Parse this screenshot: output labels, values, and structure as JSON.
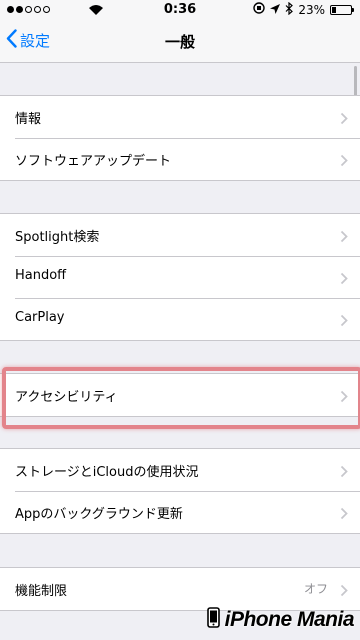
{
  "status_bar": {
    "time": "0:36",
    "battery": "23%",
    "signal_dots": 2
  },
  "nav": {
    "back_label": "設定",
    "title": "一般"
  },
  "groups": [
    {
      "rows": [
        {
          "label": "情報"
        },
        {
          "label": "ソフトウェアアップデート"
        }
      ]
    },
    {
      "rows": [
        {
          "label": "Spotlight検索"
        },
        {
          "label": "Handoff"
        },
        {
          "label": "CarPlay"
        }
      ]
    },
    {
      "rows": [
        {
          "label": "アクセシビリティ",
          "highlighted": true
        }
      ]
    },
    {
      "rows": [
        {
          "label": "ストレージとiCloudの使用状況"
        },
        {
          "label": "Appのバックグラウンド更新"
        }
      ]
    },
    {
      "rows": [
        {
          "label": "機能制限",
          "value": "オフ"
        }
      ]
    }
  ],
  "watermark": {
    "text": "iPhone Mania"
  },
  "colors": {
    "accent": "#007aff",
    "highlight": "#e3848b",
    "chevron": "#c7c7cc",
    "background": "#efeff4"
  }
}
